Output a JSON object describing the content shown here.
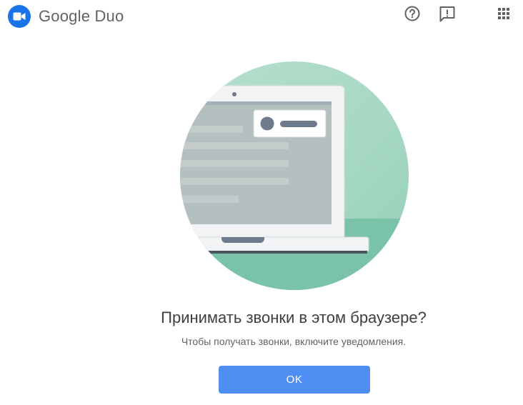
{
  "header": {
    "app_name": "Google Duo",
    "logo_icon": "duo-video-camera-icon",
    "help_icon": "help-circle-icon",
    "feedback_icon": "feedback-icon",
    "apps_icon": "apps-grid-icon"
  },
  "dialog": {
    "illustration": "laptop-notification-illustration",
    "title": "Принимать звонки в этом браузере?",
    "subtitle": "Чтобы получать звонки, включите уведомления.",
    "ok_label": "OK"
  },
  "colors": {
    "brand_blue": "#1a73e8",
    "button_blue": "#4f8ef3",
    "teal_circle": "#8fcfb8",
    "text_dark": "#3c4043",
    "text_gray": "#5f6368"
  }
}
